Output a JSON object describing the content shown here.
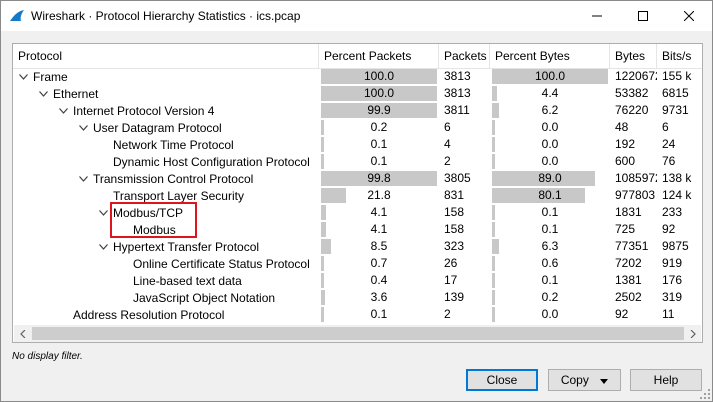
{
  "window": {
    "title": "Wireshark · Protocol Hierarchy Statistics · ics.pcap"
  },
  "columns": [
    "Protocol",
    "Percent Packets",
    "Packets",
    "Percent Bytes",
    "Bytes",
    "Bits/s"
  ],
  "rows": [
    {
      "protocol": "Frame",
      "depth": 0,
      "expanded": true,
      "pct_packets": "100.0",
      "pct_packets_val": 100.0,
      "packets": "3813",
      "pct_bytes": "100.0",
      "pct_bytes_val": 100.0,
      "bytes": "1220672",
      "bits": "155 k"
    },
    {
      "protocol": "Ethernet",
      "depth": 1,
      "expanded": true,
      "pct_packets": "100.0",
      "pct_packets_val": 100.0,
      "packets": "3813",
      "pct_bytes": "4.4",
      "pct_bytes_val": 4.4,
      "bytes": "53382",
      "bits": "6815"
    },
    {
      "protocol": "Internet Protocol Version 4",
      "depth": 2,
      "expanded": true,
      "pct_packets": "99.9",
      "pct_packets_val": 99.9,
      "packets": "3811",
      "pct_bytes": "6.2",
      "pct_bytes_val": 6.2,
      "bytes": "76220",
      "bits": "9731"
    },
    {
      "protocol": "User Datagram Protocol",
      "depth": 3,
      "expanded": true,
      "pct_packets": "0.2",
      "pct_packets_val": 0.2,
      "packets": "6",
      "pct_bytes": "0.0",
      "pct_bytes_val": 0.0,
      "bytes": "48",
      "bits": "6"
    },
    {
      "protocol": "Network Time Protocol",
      "depth": 4,
      "expanded": null,
      "pct_packets": "0.1",
      "pct_packets_val": 0.1,
      "packets": "4",
      "pct_bytes": "0.0",
      "pct_bytes_val": 0.0,
      "bytes": "192",
      "bits": "24"
    },
    {
      "protocol": "Dynamic Host Configuration Protocol",
      "depth": 4,
      "expanded": null,
      "pct_packets": "0.1",
      "pct_packets_val": 0.1,
      "packets": "2",
      "pct_bytes": "0.0",
      "pct_bytes_val": 0.0,
      "bytes": "600",
      "bits": "76"
    },
    {
      "protocol": "Transmission Control Protocol",
      "depth": 3,
      "expanded": true,
      "pct_packets": "99.8",
      "pct_packets_val": 99.8,
      "packets": "3805",
      "pct_bytes": "89.0",
      "pct_bytes_val": 89.0,
      "bytes": "1085972",
      "bits": "138 k"
    },
    {
      "protocol": "Transport Layer Security",
      "depth": 4,
      "expanded": null,
      "pct_packets": "21.8",
      "pct_packets_val": 21.8,
      "packets": "831",
      "pct_bytes": "80.1",
      "pct_bytes_val": 80.1,
      "bytes": "977803",
      "bits": "124 k"
    },
    {
      "protocol": "Modbus/TCP",
      "depth": 4,
      "expanded": true,
      "pct_packets": "4.1",
      "pct_packets_val": 4.1,
      "packets": "158",
      "pct_bytes": "0.1",
      "pct_bytes_val": 0.1,
      "bytes": "1831",
      "bits": "233"
    },
    {
      "protocol": "Modbus",
      "depth": 5,
      "expanded": null,
      "pct_packets": "4.1",
      "pct_packets_val": 4.1,
      "packets": "158",
      "pct_bytes": "0.1",
      "pct_bytes_val": 0.1,
      "bytes": "725",
      "bits": "92"
    },
    {
      "protocol": "Hypertext Transfer Protocol",
      "depth": 4,
      "expanded": true,
      "pct_packets": "8.5",
      "pct_packets_val": 8.5,
      "packets": "323",
      "pct_bytes": "6.3",
      "pct_bytes_val": 6.3,
      "bytes": "77351",
      "bits": "9875"
    },
    {
      "protocol": "Online Certificate Status Protocol",
      "depth": 5,
      "expanded": null,
      "pct_packets": "0.7",
      "pct_packets_val": 0.7,
      "packets": "26",
      "pct_bytes": "0.6",
      "pct_bytes_val": 0.6,
      "bytes": "7202",
      "bits": "919"
    },
    {
      "protocol": "Line-based text data",
      "depth": 5,
      "expanded": null,
      "pct_packets": "0.4",
      "pct_packets_val": 0.4,
      "packets": "17",
      "pct_bytes": "0.1",
      "pct_bytes_val": 0.1,
      "bytes": "1381",
      "bits": "176"
    },
    {
      "protocol": "JavaScript Object Notation",
      "depth": 5,
      "expanded": null,
      "pct_packets": "3.6",
      "pct_packets_val": 3.6,
      "packets": "139",
      "pct_bytes": "0.2",
      "pct_bytes_val": 0.2,
      "bytes": "2502",
      "bits": "319"
    },
    {
      "protocol": "Address Resolution Protocol",
      "depth": 2,
      "expanded": null,
      "pct_packets": "0.1",
      "pct_packets_val": 0.1,
      "packets": "2",
      "pct_bytes": "0.0",
      "pct_bytes_val": 0.0,
      "bytes": "92",
      "bits": "11"
    }
  ],
  "status": {
    "filter_text": "No display filter."
  },
  "buttons": {
    "close": "Close",
    "copy": "Copy",
    "help": "Help"
  },
  "colors": {
    "bar": "#c8c8c8",
    "highlight": "#e0141e",
    "accent": "#0078d7"
  }
}
